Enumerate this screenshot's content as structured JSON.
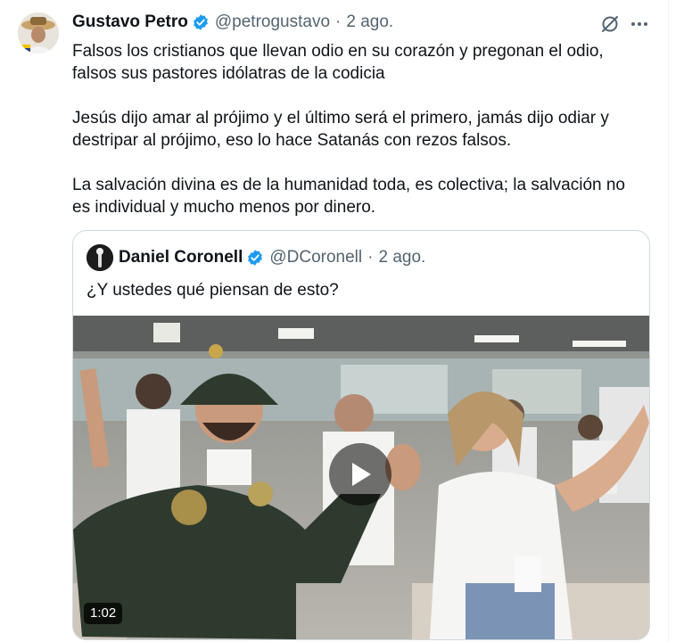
{
  "post": {
    "author_name": "Gustavo Petro",
    "handle": "@petrogustavo",
    "separator": "·",
    "date": "2 ago.",
    "paragraphs": [
      "Falsos los cristianos que llevan odio en su corazón y pregonan el odio, falsos sus pastores idólatras de la codicia",
      "Jesús dijo amar al prójimo y el último será el primero, jamás dijo odiar y destripar al prójimo, eso lo hace Satanás con rezos falsos.",
      "La salvación divina es de la humanidad toda, es colectiva; la salvación no es individual y mucho menos por dinero."
    ]
  },
  "quoted": {
    "author_name": "Daniel Coronell",
    "handle": "@DCoronell",
    "separator": "·",
    "date": "2 ago.",
    "text": "¿Y ustedes qué piensan de esto?",
    "video_duration": "1:02"
  },
  "icons": {
    "verified": "verified-badge-icon",
    "grok": "grok-icon",
    "more": "more-options-icon",
    "play": "play-icon"
  },
  "colors": {
    "verified": "#1d9bf0",
    "secondary_text": "#536471",
    "border": "#cfd9de"
  }
}
